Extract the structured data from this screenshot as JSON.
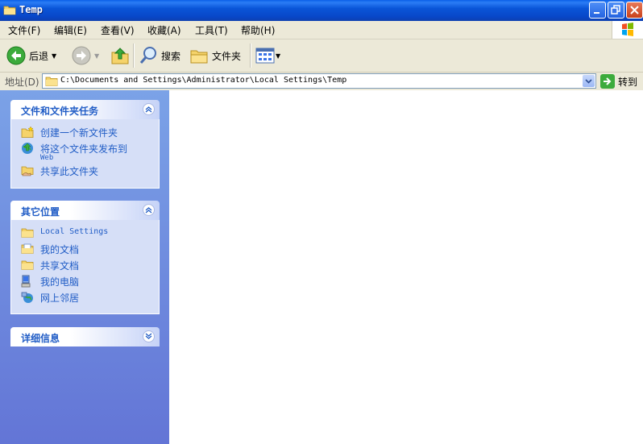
{
  "window": {
    "title": "Temp"
  },
  "menubar": {
    "items": [
      "文件(F)",
      "编辑(E)",
      "查看(V)",
      "收藏(A)",
      "工具(T)",
      "帮助(H)"
    ]
  },
  "toolbar": {
    "back_label": "后退",
    "search_label": "搜索",
    "folders_label": "文件夹"
  },
  "address": {
    "label": "地址(D)",
    "path": "C:\\Documents and Settings\\Administrator\\Local Settings\\Temp",
    "go_label": "转到"
  },
  "tasks_panel": {
    "title": "文件和文件夹任务",
    "items": [
      {
        "label": "创建一个新文件夹",
        "icon": "new-folder-icon"
      },
      {
        "label": "将这个文件夹发布到",
        "label2": "Web",
        "icon": "publish-web-icon"
      },
      {
        "label": "共享此文件夹",
        "icon": "share-folder-icon"
      }
    ]
  },
  "places_panel": {
    "title": "其它位置",
    "items": [
      {
        "label": "Local Settings",
        "icon": "folder-icon"
      },
      {
        "label": "我的文档",
        "icon": "my-documents-icon"
      },
      {
        "label": "共享文档",
        "icon": "shared-documents-icon"
      },
      {
        "label": "我的电脑",
        "icon": "my-computer-icon"
      },
      {
        "label": "网上邻居",
        "icon": "network-places-icon"
      }
    ]
  },
  "details_panel": {
    "title": "详细信息"
  },
  "colors": {
    "titlebar": "#0a55d8",
    "link": "#215dc6",
    "pane_top": "#7ba2e7",
    "pane_bottom": "#6375d6"
  }
}
